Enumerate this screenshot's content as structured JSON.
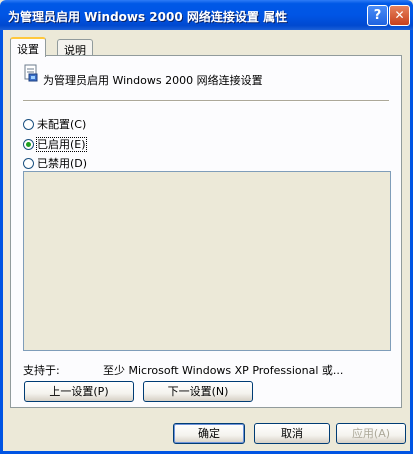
{
  "window": {
    "title": "为管理员启用 Windows 2000 网络连接设置 属性",
    "help_button": "?",
    "close_button": "✕"
  },
  "tabs": [
    {
      "label": "设置",
      "selected": true
    },
    {
      "label": "说明",
      "selected": false
    }
  ],
  "policy": {
    "icon": "policy-setting-icon",
    "name": "为管理员启用 Windows 2000 网络连接设置"
  },
  "options": [
    {
      "label": "未配置(C)",
      "checked": false
    },
    {
      "label": "已启用(E)",
      "checked": true
    },
    {
      "label": "已禁用(D)",
      "checked": false
    }
  ],
  "supported": {
    "label": "支持于:",
    "value": "至少 Microsoft Windows XP Professional 或..."
  },
  "nav_buttons": {
    "previous": "上一设置(P)",
    "next": "下一设置(N)"
  },
  "dialog_buttons": {
    "ok": "确定",
    "cancel": "取消",
    "apply": "应用(A)"
  },
  "colors": {
    "titlebar": "#0055E5",
    "face": "#ECE9D8",
    "tab_highlight": "#FFC83C",
    "radio_dot": "#21A121"
  }
}
